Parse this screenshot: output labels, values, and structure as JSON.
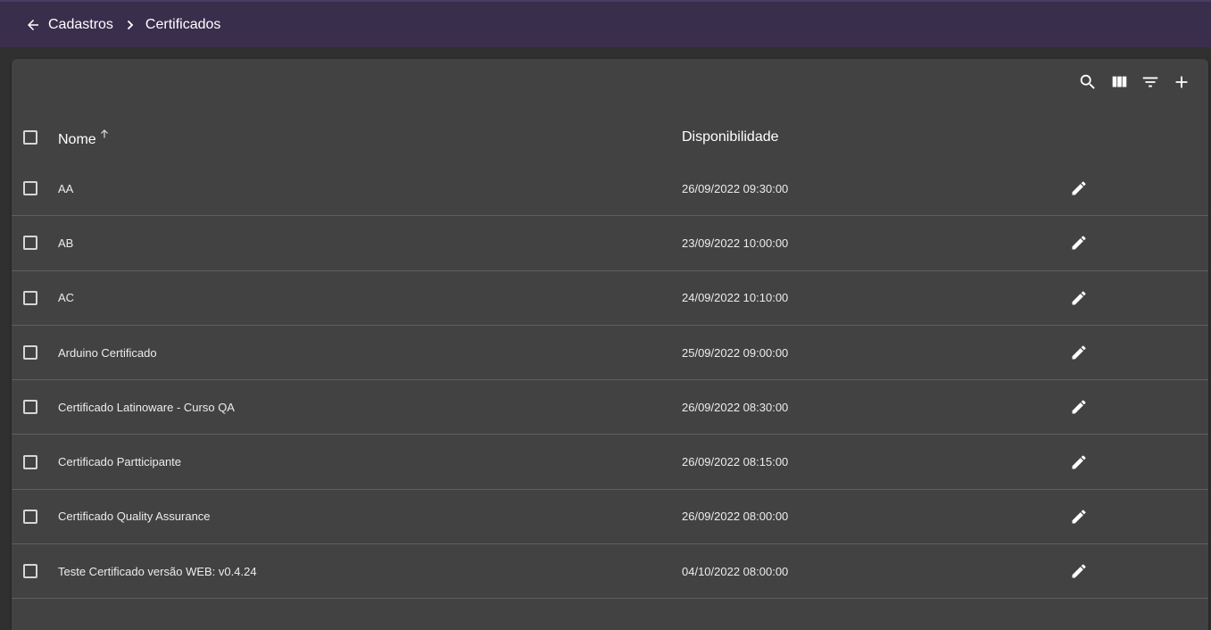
{
  "breadcrumb": {
    "items": [
      "Cadastros",
      "Certificados"
    ]
  },
  "toolbar": {
    "icons": [
      "search-icon",
      "view-columns-icon",
      "filter-icon",
      "add-icon"
    ]
  },
  "table": {
    "columns": {
      "name": "Nome",
      "availability": "Disponibilidade"
    },
    "sort": "Nome ascending",
    "rows": [
      {
        "name": "AA",
        "date": "26/09/2022 09:30:00"
      },
      {
        "name": "AB",
        "date": "23/09/2022 10:00:00"
      },
      {
        "name": "AC",
        "date": "24/09/2022 10:10:00"
      },
      {
        "name": "Arduino Certificado",
        "date": "25/09/2022 09:00:00"
      },
      {
        "name": "Certificado Latinoware - Curso QA",
        "date": "26/09/2022 08:30:00"
      },
      {
        "name": "Certificado Partticipante",
        "date": "26/09/2022 08:15:00"
      },
      {
        "name": "Certificado Quality Assurance",
        "date": "26/09/2022 08:00:00"
      },
      {
        "name": "Teste Certificado versão WEB: v0.4.24",
        "date": "04/10/2022 08:00:00"
      }
    ]
  },
  "colors": {
    "topbar": "#3a2e4d",
    "panel": "#424242",
    "background": "#303030"
  }
}
